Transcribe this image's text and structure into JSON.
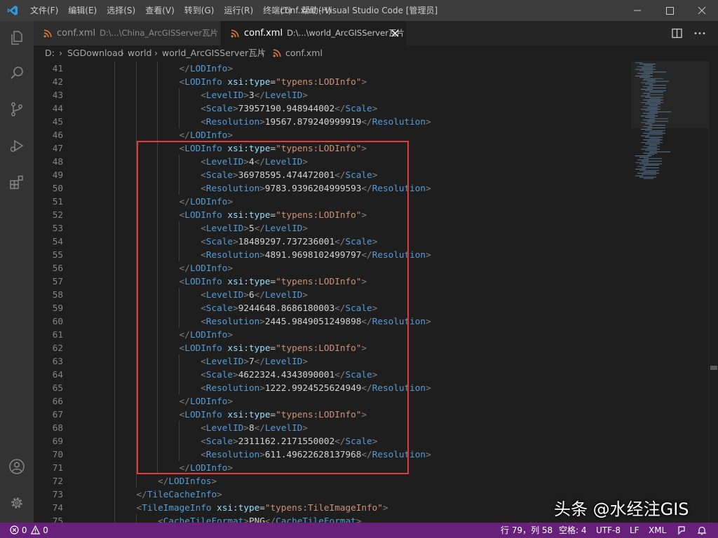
{
  "titlebar": {
    "menu": [
      "文件(F)",
      "编辑(E)",
      "选择(S)",
      "查看(V)",
      "转到(G)",
      "运行(R)",
      "终端(T)",
      "帮助(H)"
    ],
    "title": "conf.xml - Visual Studio Code [管理员]"
  },
  "tabs": [
    {
      "name": "conf.xml",
      "path": "D:\\...\\China_ArcGISServer瓦片",
      "active": false
    },
    {
      "name": "conf.xml",
      "path": "D:\\...\\world_ArcGISServer瓦片",
      "active": true
    }
  ],
  "breadcrumb": [
    "D:",
    "SGDownload",
    "world",
    "world_ArcGISServer瓦片",
    "conf.xml"
  ],
  "editor": {
    "lines": [
      {
        "n": "41",
        "indent": 6,
        "tokens": [
          [
            "p",
            "</"
          ],
          [
            "t",
            "LODInfo"
          ],
          [
            "p",
            ">"
          ]
        ]
      },
      {
        "n": "42",
        "indent": 6,
        "tokens": [
          [
            "p",
            "<"
          ],
          [
            "t",
            "LODInfo"
          ],
          [
            "x",
            " "
          ],
          [
            "a",
            "xsi:type"
          ],
          [
            "x",
            "="
          ],
          [
            "s",
            "\"typens:LODInfo\""
          ],
          [
            "p",
            ">"
          ]
        ]
      },
      {
        "n": "43",
        "indent": 8,
        "tokens": [
          [
            "p",
            "<"
          ],
          [
            "t",
            "LevelID"
          ],
          [
            "p",
            ">"
          ],
          [
            "x",
            "3"
          ],
          [
            "p",
            "</"
          ],
          [
            "t",
            "LevelID"
          ],
          [
            "p",
            ">"
          ]
        ]
      },
      {
        "n": "44",
        "indent": 8,
        "tokens": [
          [
            "p",
            "<"
          ],
          [
            "t",
            "Scale"
          ],
          [
            "p",
            ">"
          ],
          [
            "x",
            "73957190.948944002"
          ],
          [
            "p",
            "</"
          ],
          [
            "t",
            "Scale"
          ],
          [
            "p",
            ">"
          ]
        ]
      },
      {
        "n": "45",
        "indent": 8,
        "tokens": [
          [
            "p",
            "<"
          ],
          [
            "t",
            "Resolution"
          ],
          [
            "p",
            ">"
          ],
          [
            "x",
            "19567.879240999919"
          ],
          [
            "p",
            "</"
          ],
          [
            "t",
            "Resolution"
          ],
          [
            "p",
            ">"
          ]
        ]
      },
      {
        "n": "46",
        "indent": 6,
        "tokens": [
          [
            "p",
            "</"
          ],
          [
            "t",
            "LODInfo"
          ],
          [
            "p",
            ">"
          ]
        ]
      },
      {
        "n": "47",
        "indent": 6,
        "tokens": [
          [
            "p",
            "<"
          ],
          [
            "t",
            "LODInfo"
          ],
          [
            "x",
            " "
          ],
          [
            "a",
            "xsi:type"
          ],
          [
            "x",
            "="
          ],
          [
            "s",
            "\"typens:LODInfo\""
          ],
          [
            "p",
            ">"
          ]
        ]
      },
      {
        "n": "48",
        "indent": 8,
        "tokens": [
          [
            "p",
            "<"
          ],
          [
            "t",
            "LevelID"
          ],
          [
            "p",
            ">"
          ],
          [
            "x",
            "4"
          ],
          [
            "p",
            "</"
          ],
          [
            "t",
            "LevelID"
          ],
          [
            "p",
            ">"
          ]
        ]
      },
      {
        "n": "49",
        "indent": 8,
        "tokens": [
          [
            "p",
            "<"
          ],
          [
            "t",
            "Scale"
          ],
          [
            "p",
            ">"
          ],
          [
            "x",
            "36978595.474472001"
          ],
          [
            "p",
            "</"
          ],
          [
            "t",
            "Scale"
          ],
          [
            "p",
            ">"
          ]
        ]
      },
      {
        "n": "50",
        "indent": 8,
        "tokens": [
          [
            "p",
            "<"
          ],
          [
            "t",
            "Resolution"
          ],
          [
            "p",
            ">"
          ],
          [
            "x",
            "9783.9396204999593"
          ],
          [
            "p",
            "</"
          ],
          [
            "t",
            "Resolution"
          ],
          [
            "p",
            ">"
          ]
        ]
      },
      {
        "n": "51",
        "indent": 6,
        "tokens": [
          [
            "p",
            "</"
          ],
          [
            "t",
            "LODInfo"
          ],
          [
            "p",
            ">"
          ]
        ]
      },
      {
        "n": "52",
        "indent": 6,
        "tokens": [
          [
            "p",
            "<"
          ],
          [
            "t",
            "LODInfo"
          ],
          [
            "x",
            " "
          ],
          [
            "a",
            "xsi:type"
          ],
          [
            "x",
            "="
          ],
          [
            "s",
            "\"typens:LODInfo\""
          ],
          [
            "p",
            ">"
          ]
        ]
      },
      {
        "n": "53",
        "indent": 8,
        "tokens": [
          [
            "p",
            "<"
          ],
          [
            "t",
            "LevelID"
          ],
          [
            "p",
            ">"
          ],
          [
            "x",
            "5"
          ],
          [
            "p",
            "</"
          ],
          [
            "t",
            "LevelID"
          ],
          [
            "p",
            ">"
          ]
        ]
      },
      {
        "n": "54",
        "indent": 8,
        "tokens": [
          [
            "p",
            "<"
          ],
          [
            "t",
            "Scale"
          ],
          [
            "p",
            ">"
          ],
          [
            "x",
            "18489297.737236001"
          ],
          [
            "p",
            "</"
          ],
          [
            "t",
            "Scale"
          ],
          [
            "p",
            ">"
          ]
        ]
      },
      {
        "n": "55",
        "indent": 8,
        "tokens": [
          [
            "p",
            "<"
          ],
          [
            "t",
            "Resolution"
          ],
          [
            "p",
            ">"
          ],
          [
            "x",
            "4891.9698102499797"
          ],
          [
            "p",
            "</"
          ],
          [
            "t",
            "Resolution"
          ],
          [
            "p",
            ">"
          ]
        ]
      },
      {
        "n": "56",
        "indent": 6,
        "tokens": [
          [
            "p",
            "</"
          ],
          [
            "t",
            "LODInfo"
          ],
          [
            "p",
            ">"
          ]
        ]
      },
      {
        "n": "57",
        "indent": 6,
        "tokens": [
          [
            "p",
            "<"
          ],
          [
            "t",
            "LODInfo"
          ],
          [
            "x",
            " "
          ],
          [
            "a",
            "xsi:type"
          ],
          [
            "x",
            "="
          ],
          [
            "s",
            "\"typens:LODInfo\""
          ],
          [
            "p",
            ">"
          ]
        ]
      },
      {
        "n": "58",
        "indent": 8,
        "tokens": [
          [
            "p",
            "<"
          ],
          [
            "t",
            "LevelID"
          ],
          [
            "p",
            ">"
          ],
          [
            "x",
            "6"
          ],
          [
            "p",
            "</"
          ],
          [
            "t",
            "LevelID"
          ],
          [
            "p",
            ">"
          ]
        ]
      },
      {
        "n": "59",
        "indent": 8,
        "tokens": [
          [
            "p",
            "<"
          ],
          [
            "t",
            "Scale"
          ],
          [
            "p",
            ">"
          ],
          [
            "x",
            "9244648.8686180003"
          ],
          [
            "p",
            "</"
          ],
          [
            "t",
            "Scale"
          ],
          [
            "p",
            ">"
          ]
        ]
      },
      {
        "n": "60",
        "indent": 8,
        "tokens": [
          [
            "p",
            "<"
          ],
          [
            "t",
            "Resolution"
          ],
          [
            "p",
            ">"
          ],
          [
            "x",
            "2445.9849051249898"
          ],
          [
            "p",
            "</"
          ],
          [
            "t",
            "Resolution"
          ],
          [
            "p",
            ">"
          ]
        ]
      },
      {
        "n": "61",
        "indent": 6,
        "tokens": [
          [
            "p",
            "</"
          ],
          [
            "t",
            "LODInfo"
          ],
          [
            "p",
            ">"
          ]
        ]
      },
      {
        "n": "62",
        "indent": 6,
        "tokens": [
          [
            "p",
            "<"
          ],
          [
            "t",
            "LODInfo"
          ],
          [
            "x",
            " "
          ],
          [
            "a",
            "xsi:type"
          ],
          [
            "x",
            "="
          ],
          [
            "s",
            "\"typens:LODInfo\""
          ],
          [
            "p",
            ">"
          ]
        ]
      },
      {
        "n": "63",
        "indent": 8,
        "tokens": [
          [
            "p",
            "<"
          ],
          [
            "t",
            "LevelID"
          ],
          [
            "p",
            ">"
          ],
          [
            "x",
            "7"
          ],
          [
            "p",
            "</"
          ],
          [
            "t",
            "LevelID"
          ],
          [
            "p",
            ">"
          ]
        ]
      },
      {
        "n": "64",
        "indent": 8,
        "tokens": [
          [
            "p",
            "<"
          ],
          [
            "t",
            "Scale"
          ],
          [
            "p",
            ">"
          ],
          [
            "x",
            "4622324.4343090001"
          ],
          [
            "p",
            "</"
          ],
          [
            "t",
            "Scale"
          ],
          [
            "p",
            ">"
          ]
        ]
      },
      {
        "n": "65",
        "indent": 8,
        "tokens": [
          [
            "p",
            "<"
          ],
          [
            "t",
            "Resolution"
          ],
          [
            "p",
            ">"
          ],
          [
            "x",
            "1222.9924525624949"
          ],
          [
            "p",
            "</"
          ],
          [
            "t",
            "Resolution"
          ],
          [
            "p",
            ">"
          ]
        ]
      },
      {
        "n": "66",
        "indent": 6,
        "tokens": [
          [
            "p",
            "</"
          ],
          [
            "t",
            "LODInfo"
          ],
          [
            "p",
            ">"
          ]
        ]
      },
      {
        "n": "67",
        "indent": 6,
        "tokens": [
          [
            "p",
            "<"
          ],
          [
            "t",
            "LODInfo"
          ],
          [
            "x",
            " "
          ],
          [
            "a",
            "xsi:type"
          ],
          [
            "x",
            "="
          ],
          [
            "s",
            "\"typens:LODInfo\""
          ],
          [
            "p",
            ">"
          ]
        ]
      },
      {
        "n": "68",
        "indent": 8,
        "tokens": [
          [
            "p",
            "<"
          ],
          [
            "t",
            "LevelID"
          ],
          [
            "p",
            ">"
          ],
          [
            "x",
            "8"
          ],
          [
            "p",
            "</"
          ],
          [
            "t",
            "LevelID"
          ],
          [
            "p",
            ">"
          ]
        ]
      },
      {
        "n": "69",
        "indent": 8,
        "tokens": [
          [
            "p",
            "<"
          ],
          [
            "t",
            "Scale"
          ],
          [
            "p",
            ">"
          ],
          [
            "x",
            "2311162.2171550002"
          ],
          [
            "p",
            "</"
          ],
          [
            "t",
            "Scale"
          ],
          [
            "p",
            ">"
          ]
        ]
      },
      {
        "n": "70",
        "indent": 8,
        "tokens": [
          [
            "p",
            "<"
          ],
          [
            "t",
            "Resolution"
          ],
          [
            "p",
            ">"
          ],
          [
            "x",
            "611.49622628137968"
          ],
          [
            "p",
            "</"
          ],
          [
            "t",
            "Resolution"
          ],
          [
            "p",
            ">"
          ]
        ]
      },
      {
        "n": "71",
        "indent": 6,
        "tokens": [
          [
            "p",
            "</"
          ],
          [
            "t",
            "LODInfo"
          ],
          [
            "p",
            ">"
          ]
        ]
      },
      {
        "n": "72",
        "indent": 4,
        "tokens": [
          [
            "p",
            "</"
          ],
          [
            "t",
            "LODInfos"
          ],
          [
            "p",
            ">"
          ]
        ]
      },
      {
        "n": "73",
        "indent": 2,
        "tokens": [
          [
            "p",
            "</"
          ],
          [
            "t",
            "TileCacheInfo"
          ],
          [
            "p",
            ">"
          ]
        ]
      },
      {
        "n": "74",
        "indent": 2,
        "tokens": [
          [
            "p",
            "<"
          ],
          [
            "t",
            "TileImageInfo"
          ],
          [
            "x",
            " "
          ],
          [
            "a",
            "xsi:type"
          ],
          [
            "x",
            "="
          ],
          [
            "s",
            "\"typens:TileImageInfo\""
          ],
          [
            "p",
            ">"
          ]
        ]
      },
      {
        "n": "75",
        "indent": 4,
        "tokens": [
          [
            "p",
            "<"
          ],
          [
            "t",
            "CacheTileFormat"
          ],
          [
            "p",
            ">"
          ],
          [
            "x",
            "PNG"
          ],
          [
            "p",
            "</"
          ],
          [
            "t",
            "CacheTileFormat"
          ],
          [
            "p",
            ">"
          ]
        ]
      }
    ]
  },
  "statusbar": {
    "errors": "0",
    "warnings": "0",
    "position": "行 79，列 58",
    "spaces": "空格: 4",
    "encoding": "UTF-8",
    "eol": "LF",
    "language": "XML"
  },
  "watermark": "头条 @水经注GIS",
  "colors": {
    "tag": "#569cd6",
    "attribute": "#9cdcfe",
    "string": "#ce9178",
    "punctuation": "#808080",
    "text": "#d4d4d4",
    "statusbar": "#68217a",
    "highlight_box": "#e03c3c"
  }
}
